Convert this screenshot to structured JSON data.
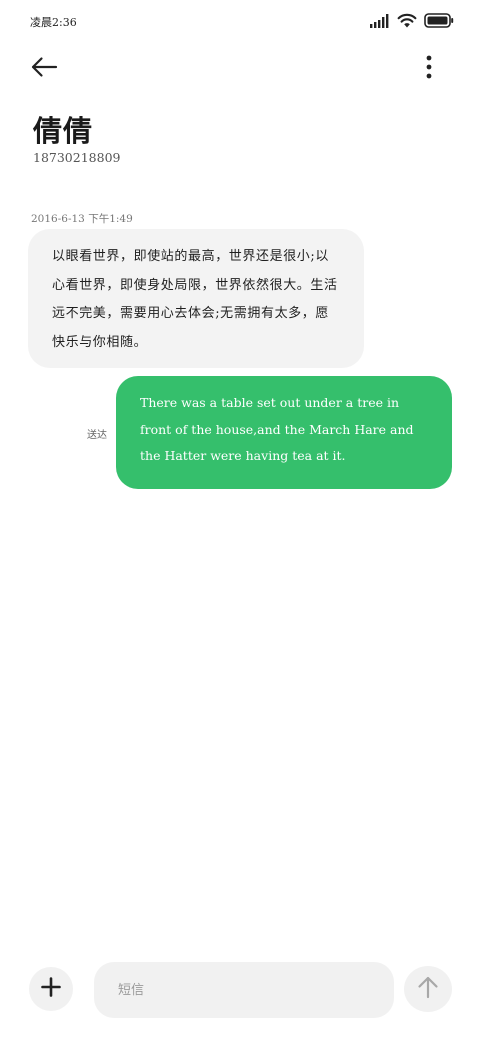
{
  "status_bar": {
    "time": "凌晨2:36",
    "icons": [
      "signal-icon",
      "wifi-icon",
      "battery-icon"
    ]
  },
  "header": {
    "back_icon": "arrow-left-icon",
    "more_icon": "more-vertical-icon",
    "contact_name": "倩倩",
    "contact_number": "18730218809"
  },
  "conversation": {
    "timestamp": "2016-6-13 下午1:49",
    "messages": [
      {
        "direction": "incoming",
        "text": "以眼看世界，即使站的最高，世界还是很小;以心看世界，即使身处局限，世界依然很大。生活远不完美，需要用心去体会;无需拥有太多，愿快乐与你相随。"
      },
      {
        "direction": "outgoing",
        "text": "There was a table set out under a tree in front of the house,and the March Hare and the Hatter were having tea at it.",
        "status": "送达"
      }
    ]
  },
  "composer": {
    "add_icon": "plus-icon",
    "placeholder": "短信",
    "value": "",
    "send_icon": "arrow-up-icon"
  },
  "colors": {
    "outgoing_bubble": "#35bf6c",
    "incoming_bubble": "#f3f3f3",
    "input_background": "#f1f1f1"
  }
}
